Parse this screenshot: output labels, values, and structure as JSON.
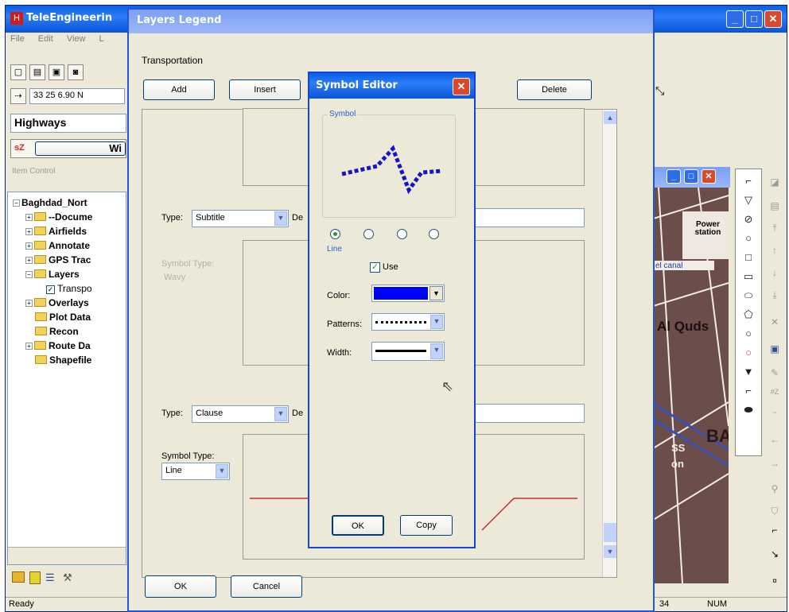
{
  "main_window": {
    "title": "TeleEngineerin",
    "menu": [
      "File",
      "Edit",
      "View",
      "L"
    ],
    "coord_field": "33 25  6.90 N",
    "layer_combo": "Highways",
    "wi_button": "Wi",
    "item_control_label": "Item Control",
    "status_text": "Ready",
    "status_num": "NUM",
    "status_partial": "34",
    "controls": {
      "minimize": "_",
      "maximize": "□",
      "close": "✕"
    }
  },
  "tree": {
    "root": "Baghdad_Nort",
    "items": [
      {
        "label": "--Docume",
        "expander": "+"
      },
      {
        "label": "Airfields",
        "expander": "+"
      },
      {
        "label": "Annotate",
        "expander": "+"
      },
      {
        "label": "GPS Trac",
        "expander": "+"
      },
      {
        "label": "Layers",
        "expander": "−"
      },
      {
        "label": "Transpo",
        "checked": true
      },
      {
        "label": "Overlays",
        "expander": "+"
      },
      {
        "label": "Plot Data",
        "expander": ""
      },
      {
        "label": "Recon",
        "expander": ""
      },
      {
        "label": "Route Da",
        "expander": "+"
      },
      {
        "label": "Shapefile",
        "expander": ""
      }
    ]
  },
  "map": {
    "labels": [
      "Power station",
      "el canal",
      "Al Quds",
      "BA",
      "SS",
      "on"
    ]
  },
  "legend_dialog": {
    "title": "Layers Legend",
    "section_label": "Transportation",
    "buttons": {
      "add": "Add",
      "insert": "Insert",
      "delete": "Delete",
      "ok": "OK",
      "cancel": "Cancel"
    },
    "rows": [
      {
        "type_label": "Type:",
        "type_value": "Subtitle",
        "desc_label": "De",
        "symbol_type_label": "Symbol Type:",
        "symbol_type_value": "Wavy",
        "disabled": true
      },
      {
        "type_label": "Type:",
        "type_value": "Clause",
        "desc_label": "De",
        "symbol_type_label": "Symbol Type:",
        "symbol_type_value": "Line",
        "disabled": false
      }
    ],
    "preview_color": "#cc2a2a"
  },
  "symbol_editor": {
    "title": "Symbol Editor",
    "group_label": "Symbol",
    "style_caption": "Line",
    "use_label": "Use",
    "use_checked": true,
    "color_label": "Color:",
    "color_value": "#0000ff",
    "patterns_label": "Patterns:",
    "width_label": "Width:",
    "ok_label": "OK",
    "copy_label": "Copy",
    "selected_radio": 0
  },
  "toolbar_icons": [
    "new-icon",
    "open-icon",
    "save-icon",
    "print-icon"
  ],
  "tool_icons": [
    "polyline-icon",
    "polygon-icon",
    "ellipse-icon",
    "circle-icon",
    "rectangle-icon",
    "rounded-rect-icon",
    "ellipse2-icon",
    "pentagon-icon",
    "circle2-icon",
    "circle3-icon",
    "triangle-icon",
    "arc-icon",
    "blob-icon"
  ]
}
